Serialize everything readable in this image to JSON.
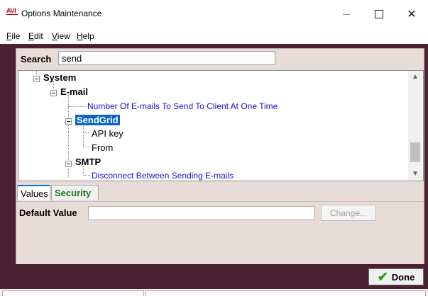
{
  "window": {
    "title": "Options Maintenance",
    "icon_text": "AVI",
    "icon": "avi-app-icon",
    "controls": [
      "minimize-icon",
      "maximize-icon",
      "close-icon"
    ]
  },
  "menu": {
    "items": [
      {
        "key": "F",
        "rest": "ile"
      },
      {
        "key": "E",
        "rest": "dit"
      },
      {
        "key": "V",
        "rest": "iew"
      },
      {
        "key": "H",
        "rest": "elp"
      }
    ]
  },
  "search": {
    "label": "Search",
    "value": "send"
  },
  "tree": {
    "nodes": [
      {
        "label": "System",
        "style": "bold"
      },
      {
        "label": "E-mail",
        "style": "bold"
      },
      {
        "label": "Number Of E-mails To Send To Client At One Time",
        "style": "blue"
      },
      {
        "label": "SendGrid",
        "style": "selected"
      },
      {
        "label": "API key",
        "style": "normal"
      },
      {
        "label": "From",
        "style": "normal"
      },
      {
        "label": "SMTP",
        "style": "bold"
      },
      {
        "label": "Disconnect Between Sending E-mails",
        "style": "blue"
      }
    ]
  },
  "tabs": [
    {
      "label": "Values",
      "active": true
    },
    {
      "label": "Security",
      "active": false
    }
  ],
  "values": {
    "default_value_label": "Default Value",
    "default_value": "",
    "change_label": "Change..."
  },
  "footer": {
    "done_label": "Done",
    "done_icon": "check-icon"
  },
  "colors": {
    "frame": "#4b2030",
    "panel": "#e8dcd9",
    "selection": "#0a64c8",
    "link_blue": "#1414d2",
    "security_tab_green": "#1a7a1a",
    "done_check_green": "#2a9a1a"
  }
}
